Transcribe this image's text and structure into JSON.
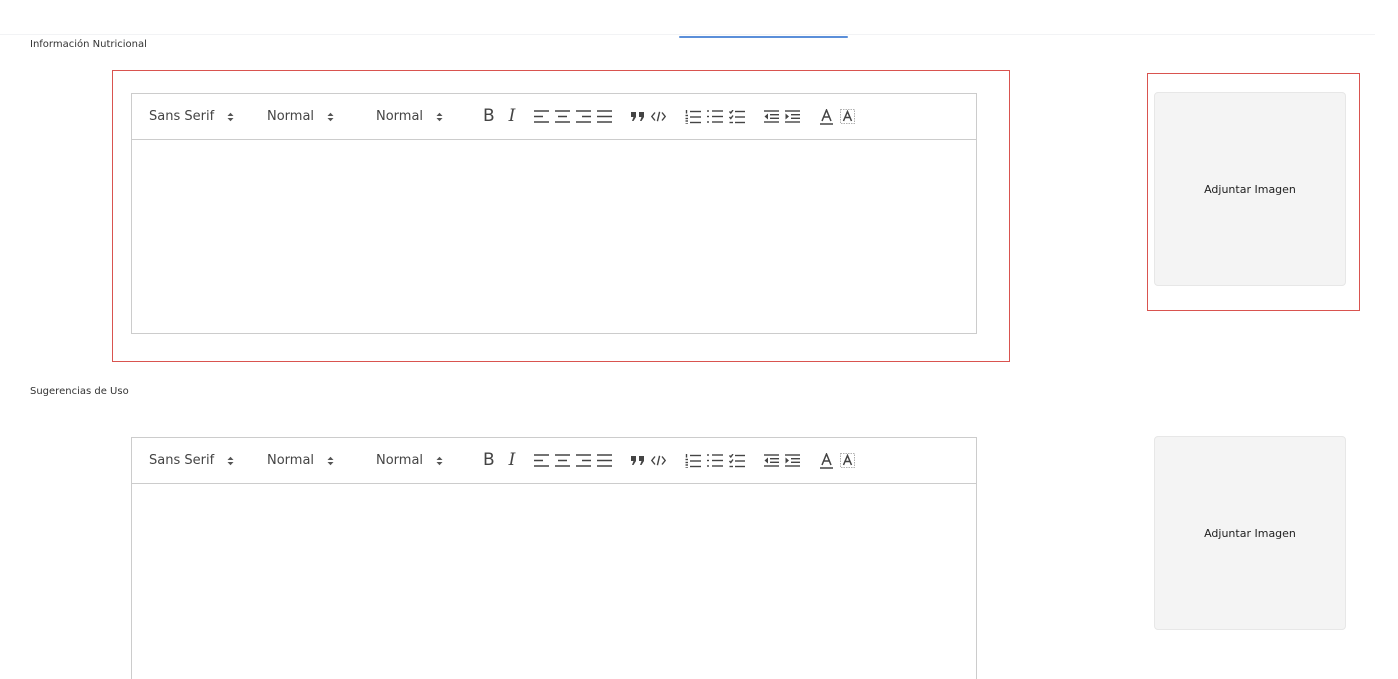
{
  "sections": [
    {
      "label": "Información Nutricional",
      "toolbar": {
        "font": "Sans Serif",
        "size": "Normal",
        "header": "Normal"
      },
      "attach_label": "Adjuntar Imagen"
    },
    {
      "label": "Sugerencias de Uso",
      "toolbar": {
        "font": "Sans Serif",
        "size": "Normal",
        "header": "Normal"
      },
      "attach_label": "Adjuntar Imagen"
    }
  ],
  "icons": {
    "bold": "B",
    "italic": "I",
    "align": [
      "align-left-icon",
      "align-center-icon",
      "align-right-icon",
      "align-justify-icon"
    ],
    "blockquote": "quote-icon",
    "code": "code-icon",
    "lists": [
      "ordered-list-icon",
      "bullet-list-icon",
      "check-list-icon"
    ],
    "indent": [
      "outdent-icon",
      "indent-icon"
    ],
    "color": [
      "text-color-icon",
      "background-color-icon"
    ]
  },
  "colors": {
    "highlight_border": "#d9534f",
    "tab_indicator": "#5b8fd9",
    "attach_bg": "#f4f4f4",
    "editor_border": "#cccccc"
  }
}
